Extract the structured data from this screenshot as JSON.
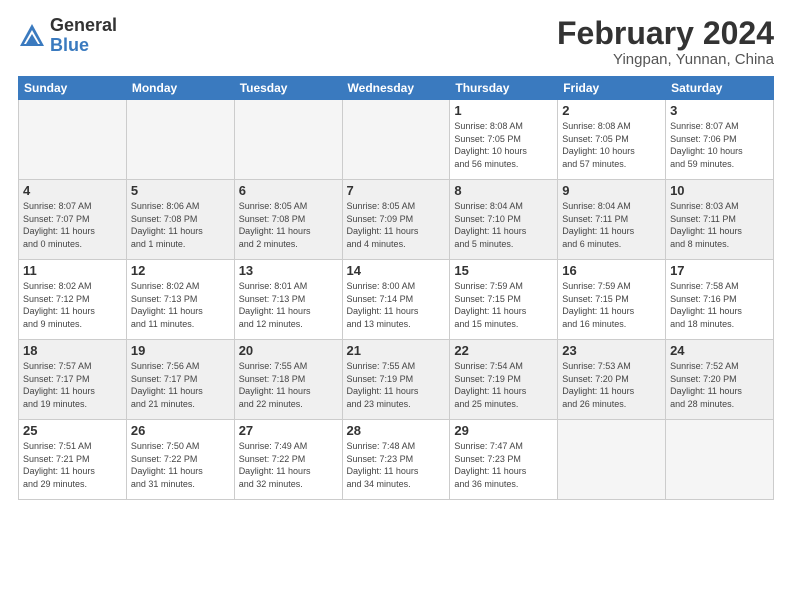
{
  "header": {
    "logo_general": "General",
    "logo_blue": "Blue",
    "main_title": "February 2024",
    "subtitle": "Yingpan, Yunnan, China"
  },
  "days_of_week": [
    "Sunday",
    "Monday",
    "Tuesday",
    "Wednesday",
    "Thursday",
    "Friday",
    "Saturday"
  ],
  "weeks": [
    [
      {
        "day": "",
        "info": ""
      },
      {
        "day": "",
        "info": ""
      },
      {
        "day": "",
        "info": ""
      },
      {
        "day": "",
        "info": ""
      },
      {
        "day": "1",
        "info": "Sunrise: 8:08 AM\nSunset: 7:05 PM\nDaylight: 10 hours\nand 56 minutes."
      },
      {
        "day": "2",
        "info": "Sunrise: 8:08 AM\nSunset: 7:05 PM\nDaylight: 10 hours\nand 57 minutes."
      },
      {
        "day": "3",
        "info": "Sunrise: 8:07 AM\nSunset: 7:06 PM\nDaylight: 10 hours\nand 59 minutes."
      }
    ],
    [
      {
        "day": "4",
        "info": "Sunrise: 8:07 AM\nSunset: 7:07 PM\nDaylight: 11 hours\nand 0 minutes."
      },
      {
        "day": "5",
        "info": "Sunrise: 8:06 AM\nSunset: 7:08 PM\nDaylight: 11 hours\nand 1 minute."
      },
      {
        "day": "6",
        "info": "Sunrise: 8:05 AM\nSunset: 7:08 PM\nDaylight: 11 hours\nand 2 minutes."
      },
      {
        "day": "7",
        "info": "Sunrise: 8:05 AM\nSunset: 7:09 PM\nDaylight: 11 hours\nand 4 minutes."
      },
      {
        "day": "8",
        "info": "Sunrise: 8:04 AM\nSunset: 7:10 PM\nDaylight: 11 hours\nand 5 minutes."
      },
      {
        "day": "9",
        "info": "Sunrise: 8:04 AM\nSunset: 7:11 PM\nDaylight: 11 hours\nand 6 minutes."
      },
      {
        "day": "10",
        "info": "Sunrise: 8:03 AM\nSunset: 7:11 PM\nDaylight: 11 hours\nand 8 minutes."
      }
    ],
    [
      {
        "day": "11",
        "info": "Sunrise: 8:02 AM\nSunset: 7:12 PM\nDaylight: 11 hours\nand 9 minutes."
      },
      {
        "day": "12",
        "info": "Sunrise: 8:02 AM\nSunset: 7:13 PM\nDaylight: 11 hours\nand 11 minutes."
      },
      {
        "day": "13",
        "info": "Sunrise: 8:01 AM\nSunset: 7:13 PM\nDaylight: 11 hours\nand 12 minutes."
      },
      {
        "day": "14",
        "info": "Sunrise: 8:00 AM\nSunset: 7:14 PM\nDaylight: 11 hours\nand 13 minutes."
      },
      {
        "day": "15",
        "info": "Sunrise: 7:59 AM\nSunset: 7:15 PM\nDaylight: 11 hours\nand 15 minutes."
      },
      {
        "day": "16",
        "info": "Sunrise: 7:59 AM\nSunset: 7:15 PM\nDaylight: 11 hours\nand 16 minutes."
      },
      {
        "day": "17",
        "info": "Sunrise: 7:58 AM\nSunset: 7:16 PM\nDaylight: 11 hours\nand 18 minutes."
      }
    ],
    [
      {
        "day": "18",
        "info": "Sunrise: 7:57 AM\nSunset: 7:17 PM\nDaylight: 11 hours\nand 19 minutes."
      },
      {
        "day": "19",
        "info": "Sunrise: 7:56 AM\nSunset: 7:17 PM\nDaylight: 11 hours\nand 21 minutes."
      },
      {
        "day": "20",
        "info": "Sunrise: 7:55 AM\nSunset: 7:18 PM\nDaylight: 11 hours\nand 22 minutes."
      },
      {
        "day": "21",
        "info": "Sunrise: 7:55 AM\nSunset: 7:19 PM\nDaylight: 11 hours\nand 23 minutes."
      },
      {
        "day": "22",
        "info": "Sunrise: 7:54 AM\nSunset: 7:19 PM\nDaylight: 11 hours\nand 25 minutes."
      },
      {
        "day": "23",
        "info": "Sunrise: 7:53 AM\nSunset: 7:20 PM\nDaylight: 11 hours\nand 26 minutes."
      },
      {
        "day": "24",
        "info": "Sunrise: 7:52 AM\nSunset: 7:20 PM\nDaylight: 11 hours\nand 28 minutes."
      }
    ],
    [
      {
        "day": "25",
        "info": "Sunrise: 7:51 AM\nSunset: 7:21 PM\nDaylight: 11 hours\nand 29 minutes."
      },
      {
        "day": "26",
        "info": "Sunrise: 7:50 AM\nSunset: 7:22 PM\nDaylight: 11 hours\nand 31 minutes."
      },
      {
        "day": "27",
        "info": "Sunrise: 7:49 AM\nSunset: 7:22 PM\nDaylight: 11 hours\nand 32 minutes."
      },
      {
        "day": "28",
        "info": "Sunrise: 7:48 AM\nSunset: 7:23 PM\nDaylight: 11 hours\nand 34 minutes."
      },
      {
        "day": "29",
        "info": "Sunrise: 7:47 AM\nSunset: 7:23 PM\nDaylight: 11 hours\nand 36 minutes."
      },
      {
        "day": "",
        "info": ""
      },
      {
        "day": "",
        "info": ""
      }
    ]
  ]
}
